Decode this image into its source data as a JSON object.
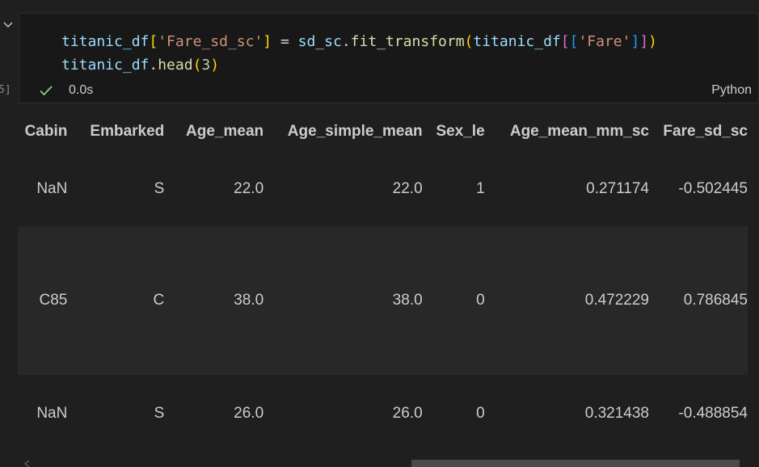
{
  "cell": {
    "exec_count": "5]",
    "status_time": "0.0s",
    "language": "Python",
    "code": {
      "line1": {
        "var": "titanic_df",
        "b1_open": "[",
        "key": "'Fare_sd_sc'",
        "b1_close": "]",
        "assign": " = ",
        "obj": "sd_sc",
        "dot": ".",
        "fn": "fit_transform",
        "p_open": "(",
        "arg_var": "titanic_df",
        "bb_open": "[",
        "bbb_open": "[",
        "arg_key": "'Fare'",
        "bbb_close": "]",
        "bb_close": "]",
        "p_close": ")"
      },
      "line2": {
        "var": "titanic_df",
        "dot": ".",
        "fn": "head",
        "p_open": "(",
        "num": "3",
        "p_close": ")"
      }
    }
  },
  "table": {
    "columns": [
      "Cabin",
      "Embarked",
      "Age_mean",
      "Age_simple_mean",
      "Sex_le",
      "Age_mean_mm_sc",
      "Fare_sd_sc"
    ],
    "rows": [
      [
        "NaN",
        "S",
        "22.0",
        "22.0",
        "1",
        "0.271174",
        "-0.502445"
      ],
      [
        "C85",
        "C",
        "38.0",
        "38.0",
        "0",
        "0.472229",
        "0.786845"
      ],
      [
        "NaN",
        "S",
        "26.0",
        "26.0",
        "0",
        "0.321438",
        "-0.488854"
      ]
    ]
  },
  "colors": {
    "background": "#1f1f1f",
    "cell_background": "#181818",
    "success_check": "#89d185",
    "scrollbar_thumb": "#4a4a4a"
  },
  "icons": {
    "gutter": "chevron-down-icon",
    "status": "check-icon",
    "scroll": "arrow-left-icon"
  }
}
